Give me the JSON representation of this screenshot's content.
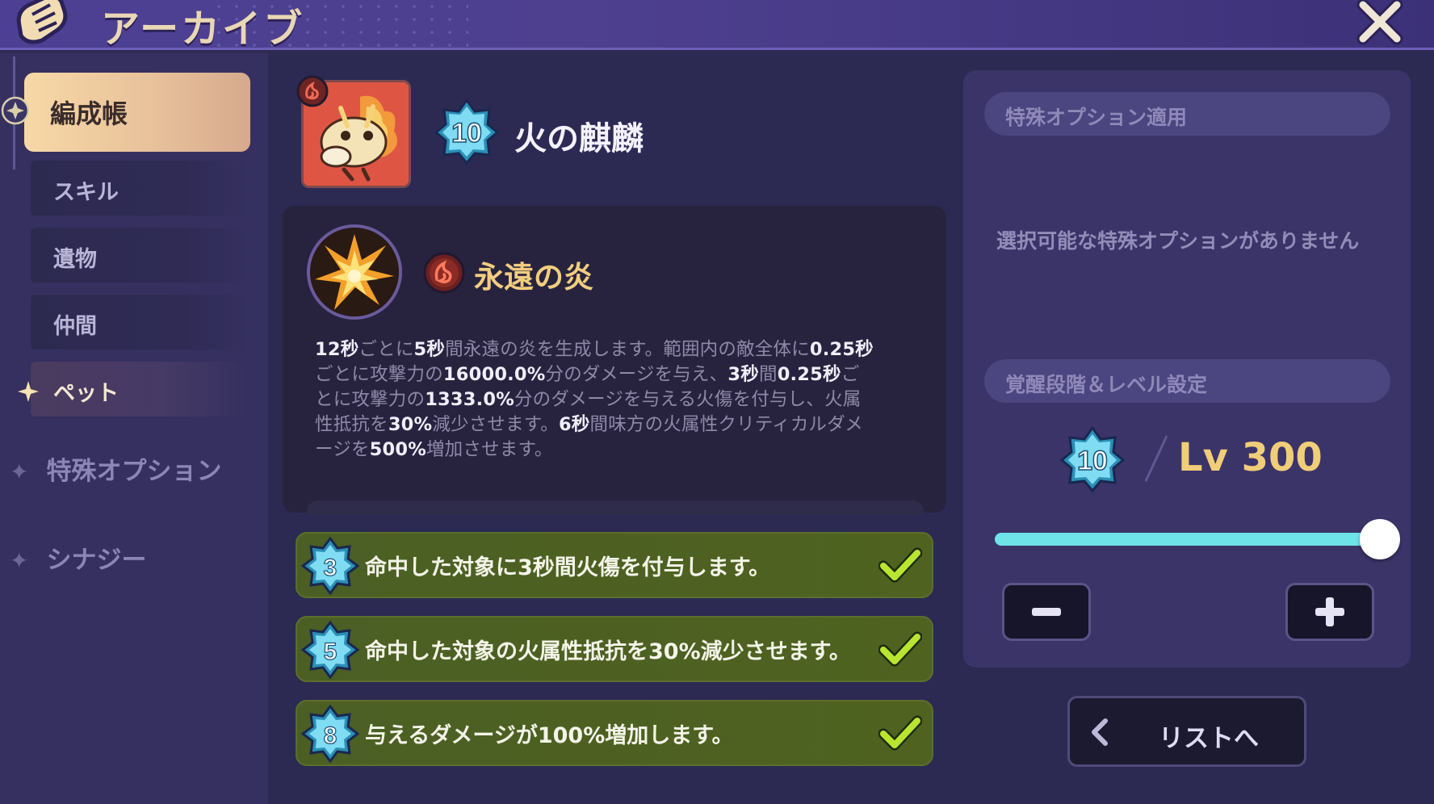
{
  "header": {
    "title": "アーカイブ"
  },
  "sidebar": {
    "active_item": "編成帳",
    "sub_items": [
      {
        "label": "スキル",
        "active": false
      },
      {
        "label": "遺物",
        "active": false
      },
      {
        "label": "仲間",
        "active": false
      },
      {
        "label": "ペット",
        "active": true
      }
    ],
    "categories": [
      {
        "label": "特殊オプション"
      },
      {
        "label": "シナジー"
      }
    ]
  },
  "pet": {
    "stars": "10",
    "name": "火の麒麟",
    "element": "fire"
  },
  "skill": {
    "name": "永遠の炎",
    "description_lines": [
      [
        [
          "b",
          "12秒"
        ],
        [
          "t",
          "ごとに"
        ],
        [
          "b",
          "5秒"
        ],
        [
          "t",
          "間永遠の炎を生成します。範囲内の敵全体に"
        ],
        [
          "b",
          "0.25秒"
        ]
      ],
      [
        [
          "t",
          "ごとに攻撃力の"
        ],
        [
          "b",
          "16000.0%"
        ],
        [
          "t",
          "分のダメージを与え、"
        ],
        [
          "b",
          "3秒"
        ],
        [
          "t",
          "間"
        ],
        [
          "b",
          "0.25秒"
        ],
        [
          "t",
          "ご"
        ]
      ],
      [
        [
          "t",
          "とに攻撃力の"
        ],
        [
          "b",
          "1333.0%"
        ],
        [
          "t",
          "分のダメージを与える火傷を付与し、火属"
        ]
      ],
      [
        [
          "t",
          "性抵抗を"
        ],
        [
          "b",
          "30%"
        ],
        [
          "t",
          "減少させます。"
        ],
        [
          "b",
          "6秒"
        ],
        [
          "t",
          "間味方の火属性クリティカルダメ"
        ]
      ],
      [
        [
          "t",
          "ージを"
        ],
        [
          "b",
          "500%"
        ],
        [
          "t",
          "増加させます。"
        ]
      ]
    ]
  },
  "perks": [
    {
      "stars": "3",
      "text": "命中した対象に3秒間火傷を付与します。",
      "unlocked": true
    },
    {
      "stars": "5",
      "text": "命中した対象の火属性抵抗を30%減少させます。",
      "unlocked": true
    },
    {
      "stars": "8",
      "text": "与えるダメージが100%増加します。",
      "unlocked": true
    }
  ],
  "right": {
    "special_header": "特殊オプション適用",
    "no_options": "選択可能な特殊オプションがありません",
    "awaken_header": "覚醒段階＆レベル設定",
    "awaken_stars": "10",
    "level_text": "Lv 300",
    "slider_fraction": 1.0,
    "list_button": "リストへ"
  },
  "colors": {
    "accent_gold": "#f0cd78",
    "slider": "#6ee3e8",
    "perk_green": "#4f6220",
    "check_lime": "#b8e630"
  }
}
